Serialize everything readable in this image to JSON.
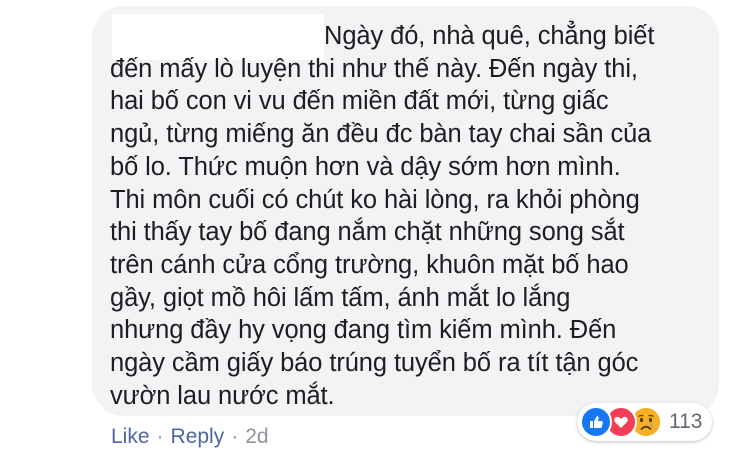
{
  "comment": {
    "text": "Ngày đó, nhà quê, chẳng biết\nđến mấy lò luyện thi như thế này. Đến ngày thi,\nhai bố con vi vu đến miền đất mới, từng giấc\nngủ, từng miếng ăn đều đc bàn tay chai sần của\nbố lo. Thức muộn hơn và dậy sớm hơn mình.\nThi môn cuối có chút ko hài lòng, ra khỏi phòng\nthi thấy tay bố đang nắm chặt những song sắt\ntrên cánh cửa cổng trường, khuôn mặt bố hao\ngầy, giọt mồ hôi lấm tấm, ánh mắt lo lắng\nnhưng đầy hy vọng đang tìm kiếm mình. Đến\nngày cầm giấy báo trúng tuyển bố ra tít tận góc\nvườn lau nước mắt."
  },
  "reactions": {
    "icons": [
      "like-icon",
      "love-icon",
      "sad-icon"
    ],
    "count": "113"
  },
  "actions": {
    "like": "Like",
    "separator": "·",
    "reply": "Reply",
    "time": "2d"
  },
  "colors": {
    "bubble": "#f2f3f5",
    "text": "#1c1e21",
    "link": "#4b67a1",
    "meta": "#90949c",
    "like": "#1877f2",
    "love": "#f33e58",
    "sad": "#f7b125"
  }
}
